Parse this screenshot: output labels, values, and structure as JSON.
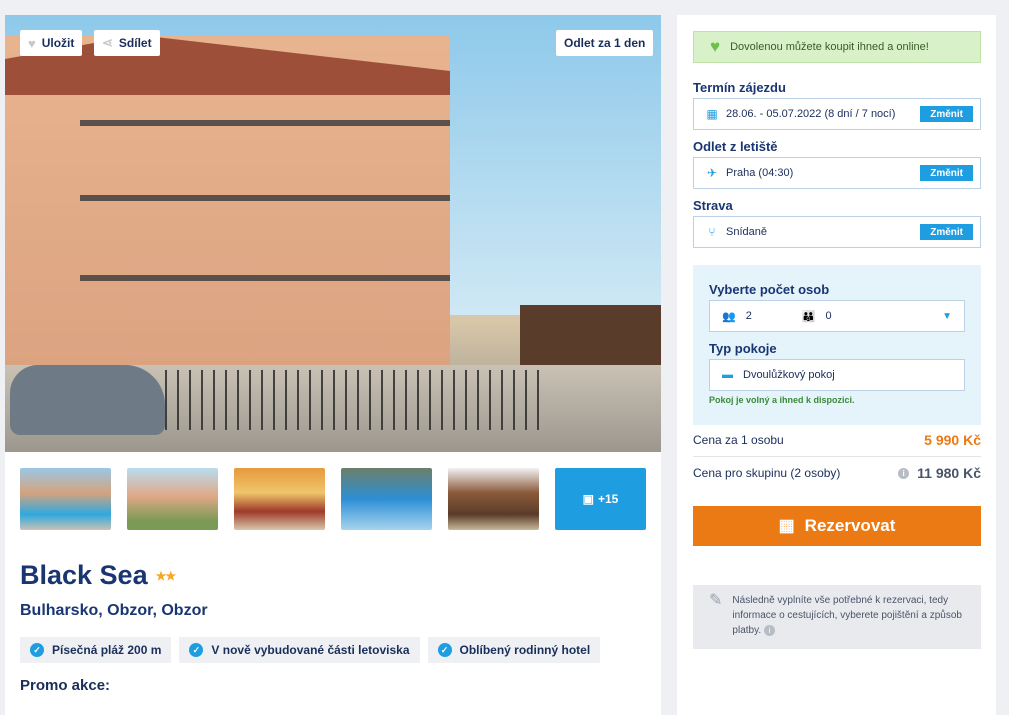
{
  "gallery": {
    "save_label": "Uložit",
    "share_label": "Sdílet",
    "departure_badge": "Odlet za 1 den",
    "more_photos": "+15"
  },
  "hotel": {
    "name": "Black Sea",
    "stars": "★★",
    "location": "Bulharsko, Obzor, Obzor",
    "tags": [
      "Písečná pláž 200 m",
      "V nově vybudované části letoviska",
      "Oblíbený rodinný hotel"
    ],
    "promo_label": "Promo akce:"
  },
  "booking": {
    "banner": "Dovolenou můžete koupit ihned a online!",
    "term_label": "Termín zájezdu",
    "term_value": "28.06. - 05.07.2022 (8 dní / 7 nocí)",
    "airport_label": "Odlet z letiště",
    "airport_value": "Praha (04:30)",
    "board_label": "Strava",
    "board_value": "Snídaně",
    "change_label": "Změnit",
    "persons_label": "Vyberte počet osob",
    "adults": "2",
    "children": "0",
    "room_label": "Typ pokoje",
    "room_value": "Dvoulůžkový pokoj",
    "availability": "Pokoj je volný a ihned k dispozici.",
    "price_person_label": "Cena za 1 osobu",
    "price_person_value": "5 990 Kč",
    "price_group_label": "Cena pro skupinu (2 osoby)",
    "price_group_value": "11 980 Kč",
    "reserve_label": "Rezervovat",
    "note": "Následně vyplníte vše potřebné k rezervaci, tedy informace o cestujících, vyberete pojištění a způsob platby."
  },
  "colors": {
    "accent": "#1e9de0",
    "cta": "#ec7a14",
    "price": "#ec7a14",
    "navy": "#1a3672"
  }
}
